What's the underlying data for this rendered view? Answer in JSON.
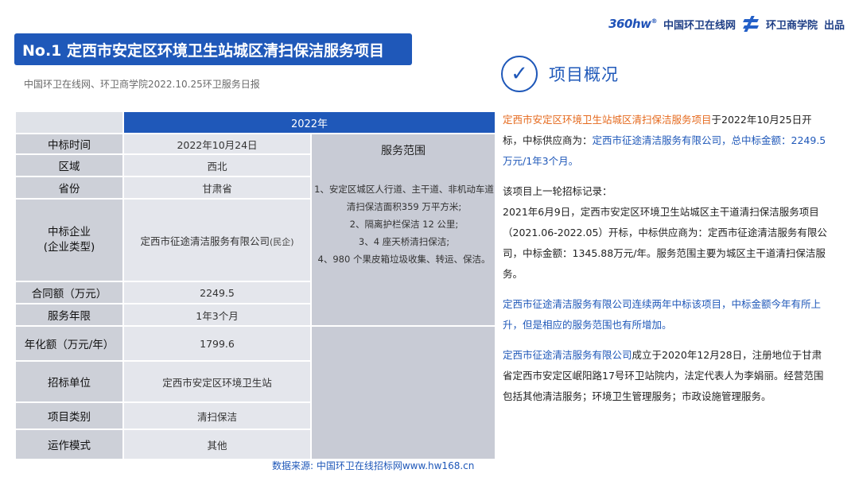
{
  "brand": {
    "logo_text": "360hw",
    "site_name": "中国环卫在线网",
    "academy": "环卫商学院",
    "produced": "出品"
  },
  "title": "No.1 定西市安定区环境卫生站城区清扫保洁服务项目",
  "subline": "中国环卫在线网、环卫商学院2022.10.25环卫服务日报",
  "overview": {
    "title": "项目概况"
  },
  "table": {
    "year": "2022年",
    "scope_header": "服务范围",
    "scope_items": [
      "1、安定区城区人行道、主干道、非机动车道清扫保洁面积359 万平方米;",
      "2、隔离护栏保洁 12 公里;",
      "3、4 座天桥清扫保洁;",
      "4、980 个果皮箱垃圾收集、转运、保洁。"
    ],
    "rows": [
      {
        "label": "中标时间",
        "value": "2022年10月24日"
      },
      {
        "label": "区域",
        "value": "西北"
      },
      {
        "label": "省份",
        "value": "甘肃省"
      },
      {
        "label": "中标企业\n(企业类型)",
        "value": "定西市征途清洁服务有限公司",
        "value_note": "(民企)"
      },
      {
        "label": "合同额（万元）",
        "value": "2249.5"
      },
      {
        "label": "服务年限",
        "value": "1年3个月"
      },
      {
        "label": "年化额（万元/年）",
        "value": "1799.6"
      },
      {
        "label": "招标单位",
        "value": "定西市安定区环境卫生站"
      },
      {
        "label": "项目类别",
        "value": "清扫保洁"
      },
      {
        "label": "运作模式",
        "value": "其他"
      }
    ]
  },
  "source": "数据来源:  中国环卫在线招标网www.hw168.cn",
  "right": {
    "p1": {
      "project": "定西市安定区环境卫生站城区清扫保洁服务项目",
      "mid": "于2022年10月25日开标，中标供应商为：",
      "winner": "定西市征途清洁服务有限公司，总中标金额：2249.5万元/1年3个月。"
    },
    "p2_head": "该项目上一轮招标记录：",
    "p2_body": "2021年6月9日，定西市安定区环境卫生站城区主干道清扫保洁服务项目（2021.06-2022.05）开标，中标供应商为：定西市征途清洁服务有限公司，中标金额：1345.88万元/年。服务范围主要为城区主干道清扫保洁服务。",
    "p3": "定西市征途清洁服务有限公司连续两年中标该项目，中标金额今年有所上升，但是相应的服务范围也有所增加。",
    "p4": {
      "company": "定西市征途清洁服务有限公司",
      "rest": "成立于2020年12月28日，注册地位于甘肃省定西市安定区岷阳路17号环卫站院内，法定代表人为李娟丽。经营范围包括其他清洁服务；环境卫生管理服务；市政设施管理服务。"
    }
  }
}
